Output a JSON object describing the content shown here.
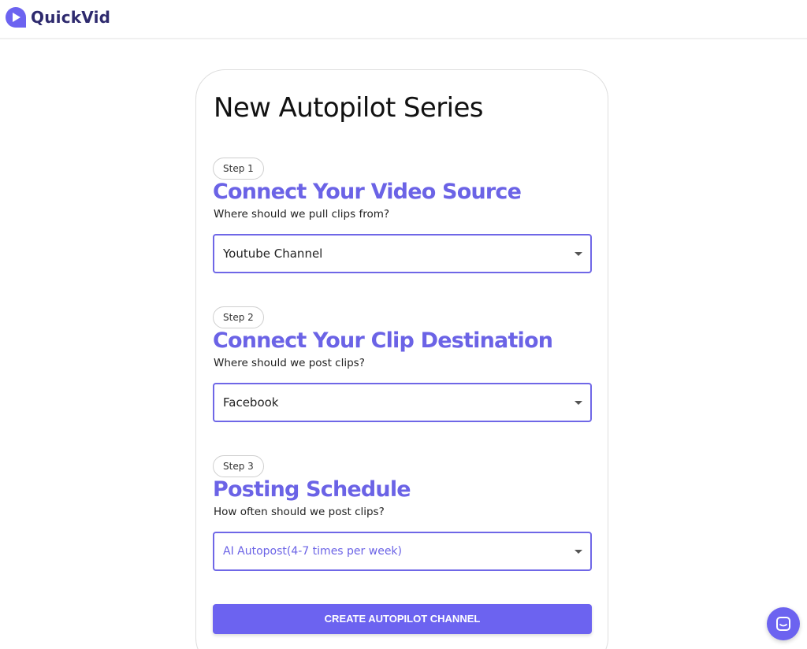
{
  "brand": {
    "name": "QuickVid",
    "logo_icon": "play-bubble-icon"
  },
  "form": {
    "title": "New Autopilot Series",
    "steps": [
      {
        "badge": "Step 1",
        "title": "Connect Your Video Source",
        "subtitle": "Where should we pull clips from?",
        "selected": "Youtube Channel"
      },
      {
        "badge": "Step 2",
        "title": "Connect Your Clip Destination",
        "subtitle": "Where should we post clips?",
        "selected": "Facebook"
      },
      {
        "badge": "Step 3",
        "title": "Posting Schedule",
        "subtitle": "How often should we post clips?",
        "selected": "AI Autopost(4-7 times per week)"
      }
    ],
    "submit_label": "CREATE AUTOPILOT CHANNEL"
  },
  "chat": {
    "icon": "chat-icon"
  },
  "colors": {
    "accent": "#6c63f0",
    "title_accent": "#6b63e6",
    "brand_text": "#2e2a6e"
  }
}
